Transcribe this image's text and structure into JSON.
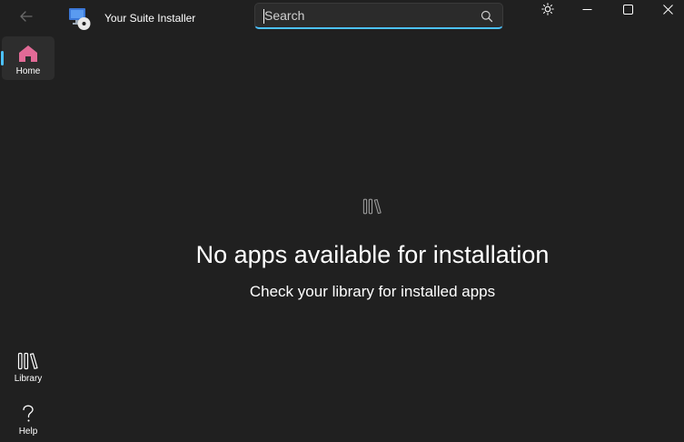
{
  "window": {
    "title": "Your Suite Installer",
    "icons": {
      "back": "back-arrow-icon",
      "app": "monitor-disc-icon",
      "theme": "brightness-icon",
      "minimize": "minimize-icon",
      "maximize": "maximize-icon",
      "close": "close-icon"
    }
  },
  "search": {
    "placeholder": "Search",
    "value": "",
    "icon": "search-icon"
  },
  "sidebar": {
    "items": [
      {
        "label": "Home",
        "icon": "home-icon",
        "selected": true
      },
      {
        "label": "Library",
        "icon": "library-icon",
        "selected": false
      },
      {
        "label": "Help",
        "icon": "question-icon",
        "selected": false
      }
    ]
  },
  "main": {
    "empty_state": {
      "icon": "library-icon",
      "title": "No apps available for installation",
      "subtitle": "Check your library for installed apps"
    }
  },
  "colors": {
    "background": "#202020",
    "accent": "#4cc2ff",
    "home_icon": "#e26a96",
    "selected_nav": "#2d2d2d"
  }
}
